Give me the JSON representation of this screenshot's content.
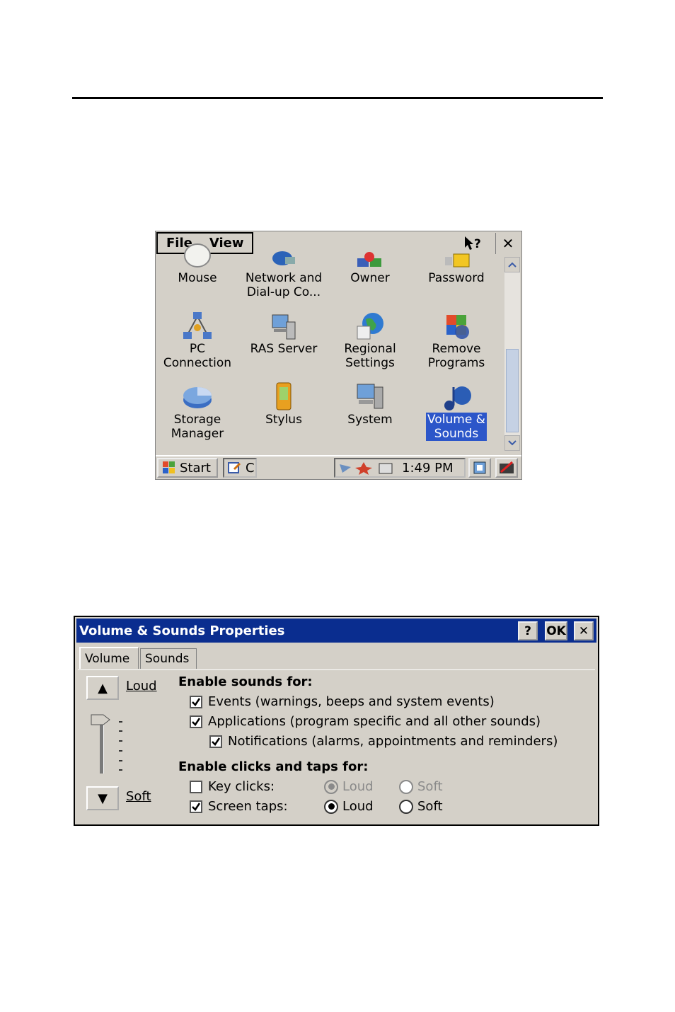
{
  "control_panel": {
    "menu": [
      "File",
      "View"
    ],
    "help_label": "?",
    "close_label": "✕",
    "items": [
      {
        "label": "Mouse",
        "icon": "mouse-icon"
      },
      {
        "label": "Network and\nDial-up Co...",
        "icon": "network-icon"
      },
      {
        "label": "Owner",
        "icon": "owner-icon"
      },
      {
        "label": "Password",
        "icon": "password-icon"
      },
      {
        "label": "PC\nConnection",
        "icon": "pc-connection-icon"
      },
      {
        "label": "RAS Server",
        "icon": "ras-server-icon"
      },
      {
        "label": "Regional\nSettings",
        "icon": "regional-settings-icon"
      },
      {
        "label": "Remove\nPrograms",
        "icon": "remove-programs-icon"
      },
      {
        "label": "Storage\nManager",
        "icon": "storage-manager-icon"
      },
      {
        "label": "Stylus",
        "icon": "stylus-icon"
      },
      {
        "label": "System",
        "icon": "system-icon"
      },
      {
        "label": "Volume &\nSounds",
        "icon": "volume-sounds-icon",
        "selected": true
      }
    ],
    "taskbar": {
      "start_label": "Start",
      "task_label": "C",
      "clock": "1:49 PM"
    }
  },
  "dialog": {
    "title": "Volume & Sounds Properties",
    "buttons": {
      "help": "?",
      "ok": "OK",
      "close": "✕"
    },
    "tabs": [
      "Volume",
      "Sounds"
    ],
    "active_tab": "Volume",
    "volume": {
      "up_arrow": "▲",
      "down_arrow": "▼",
      "loud_label": "Loud",
      "soft_label": "Soft"
    },
    "enable_sounds_heading": "Enable sounds for:",
    "events_label": "Events (warnings, beeps and system events)",
    "applications_label": "Applications (program specific and all other sounds)",
    "notifications_label": "Notifications (alarms, appointments and reminders)",
    "enable_clicks_heading": "Enable clicks and taps for:",
    "key_clicks_label": "Key clicks:",
    "screen_taps_label": "Screen taps:",
    "radio_loud": "Loud",
    "radio_soft": "Soft",
    "checked": {
      "events": true,
      "applications": true,
      "notifications": true,
      "key_clicks": false,
      "screen_taps": true
    },
    "accent_color": "#0a2d8f"
  }
}
